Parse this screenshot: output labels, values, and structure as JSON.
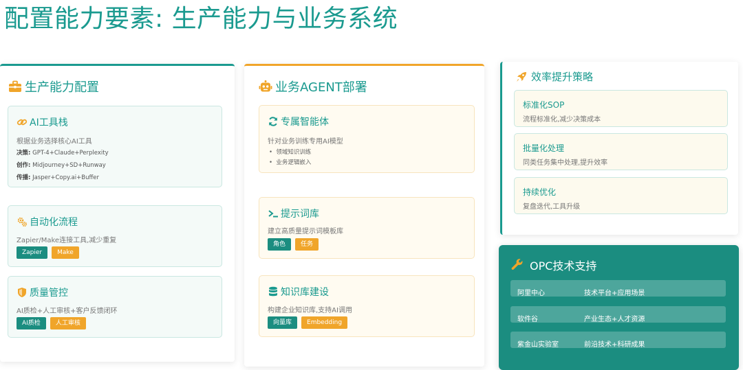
{
  "page_title": "配置能力要素: 生产能力与业务系统",
  "colors": {
    "teal": "#1a9a8f",
    "orange": "#f0a52a",
    "opc_bg": "#1b8d80"
  },
  "left_panel": {
    "title": "生产能力配置",
    "icon": "toolbox-icon",
    "cards": {
      "ai_tools": {
        "title": "AI工具栈",
        "icon": "link-icon",
        "desc": "根据业务选择核心AI工具",
        "lines": [
          {
            "label": "决策:",
            "value": " GPT-4+Claude+Perplexity"
          },
          {
            "label": "创作:",
            "value": " Midjourney+SD+Runway"
          },
          {
            "label": "传播:",
            "value": " Jasper+Copy.ai+Buffer"
          }
        ]
      },
      "automation": {
        "title": "自动化流程",
        "icon": "gears-icon",
        "desc": "Zapier/Make连接工具,减少重复",
        "tags": [
          "Zapier",
          "Make"
        ]
      },
      "quality": {
        "title": "质量管控",
        "icon": "shield-icon",
        "desc": "AI质检+人工审核+客户反馈闭环",
        "tags": [
          "AI质检",
          "人工审核"
        ]
      }
    }
  },
  "mid_panel": {
    "title": "业务AGENT部署",
    "icon": "robot-icon",
    "cards": {
      "agent": {
        "title": "专属智能体",
        "icon": "sync-icon",
        "desc": "针对业务训练专用AI模型",
        "bullets": [
          "领域知识训练",
          "业务逻辑嵌入"
        ]
      },
      "prompts": {
        "title": "提示词库",
        "icon": "terminal-icon",
        "desc": "建立高质量提示词模板库",
        "tags": [
          "角色",
          "任务"
        ]
      },
      "knowledge": {
        "title": "知识库建设",
        "icon": "database-icon",
        "desc": "构建企业知识库,支持AI调用",
        "tags": [
          "向量库",
          "Embedding"
        ]
      }
    }
  },
  "right_panel": {
    "title": "效率提升策略",
    "icon": "rocket-icon",
    "items": [
      {
        "title": "标准化SOP",
        "desc": "流程标准化,减少决策成本"
      },
      {
        "title": "批量化处理",
        "desc": "同类任务集中处理,提升效率"
      },
      {
        "title": "持续优化",
        "desc": "复盘迭代,工具升级"
      }
    ]
  },
  "opc": {
    "title": "OPC技术支持",
    "icon": "wrench-icon",
    "rows": [
      {
        "name": "阿里中心",
        "value": "技术平台+应用场景"
      },
      {
        "name": "软件谷",
        "value": "产业生态+人才资源"
      },
      {
        "name": "紫金山实验室",
        "value": "前沿技术+科研成果"
      }
    ]
  }
}
